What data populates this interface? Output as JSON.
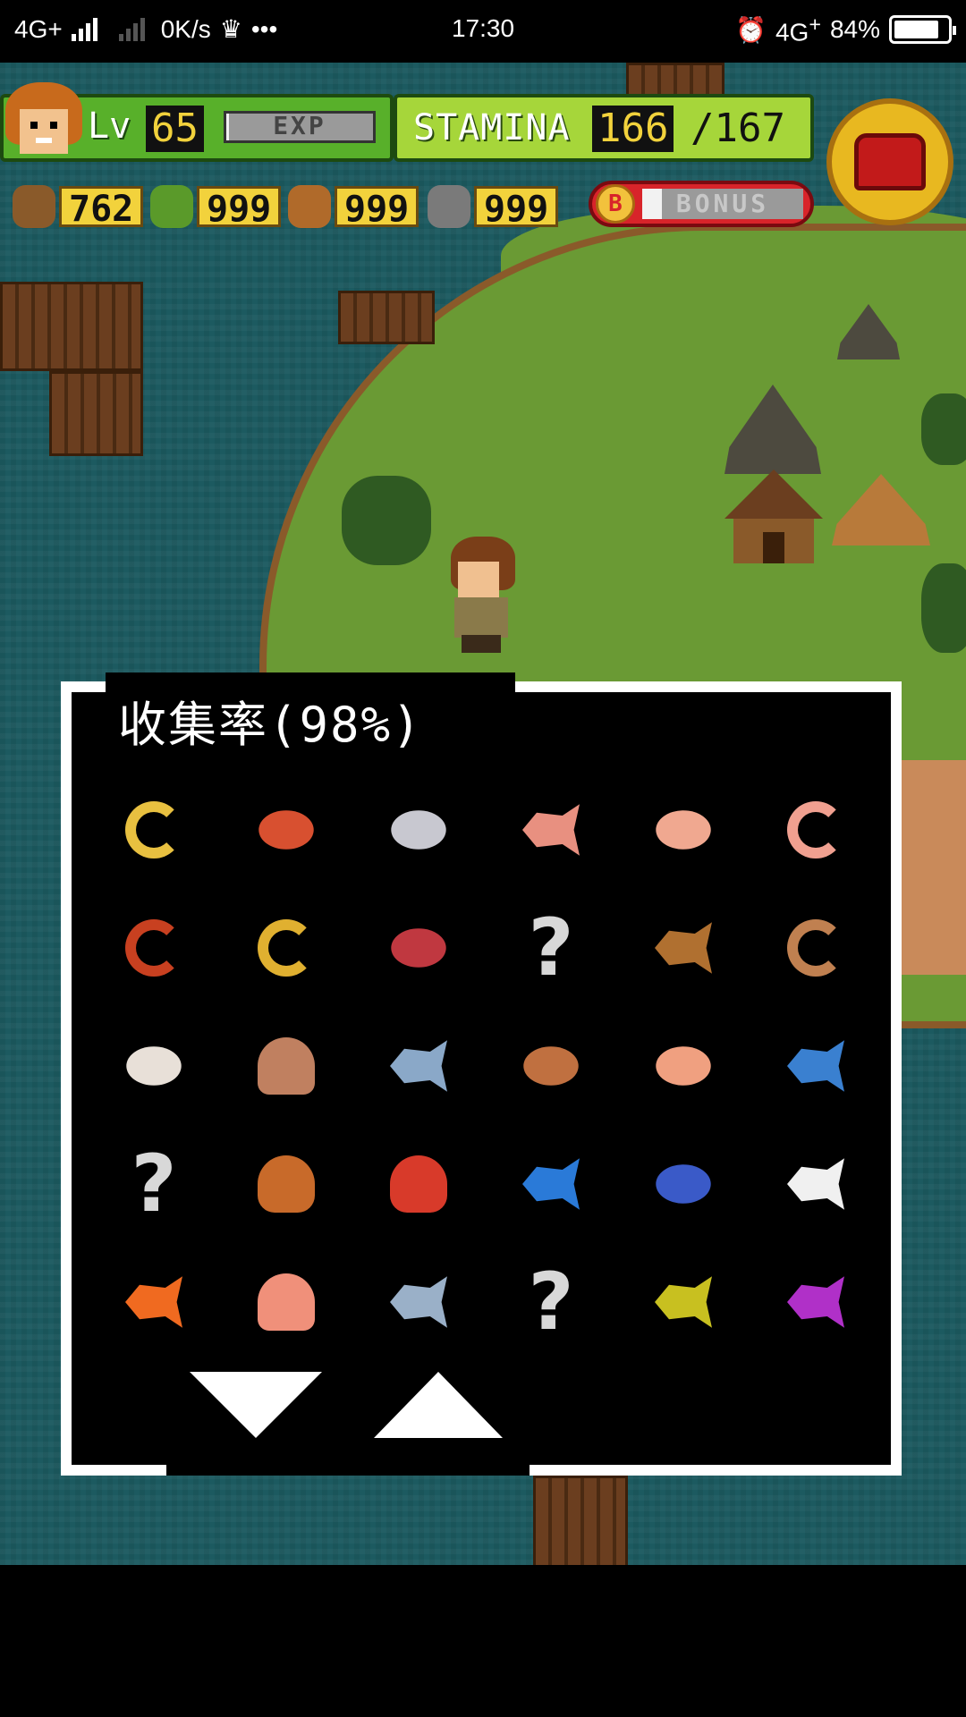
{
  "status_bar": {
    "network_left": "4G+",
    "speed": "0K/s",
    "dots": "•••",
    "time": "17:30",
    "network_right": "4G",
    "network_right_plus": "+",
    "battery": "84%",
    "battery_level": 0.84
  },
  "hud": {
    "lv_label": "Lv",
    "level": "65",
    "exp_label": "EXP",
    "exp_progress": 0.02,
    "stamina_label": "STAMINA",
    "stamina_current": "166",
    "stamina_max": "/167",
    "resources": [
      {
        "icon": "branch-icon",
        "value": "762",
        "color": "#8a5a2a"
      },
      {
        "icon": "leaf-icon",
        "value": "999",
        "color": "#5a9a2a"
      },
      {
        "icon": "nut-icon",
        "value": "999",
        "color": "#b06a2a"
      },
      {
        "icon": "stone-icon",
        "value": "999",
        "color": "#7a7a7a"
      }
    ],
    "bonus_coin": "B",
    "bonus_label": "BONUS",
    "bonus_progress": 0.12
  },
  "dialog": {
    "title": "收集率(98%)",
    "items": [
      {
        "name": "fried-shrimp-icon",
        "kind": "ring",
        "color": "#e8c040"
      },
      {
        "name": "raw-meat-icon",
        "kind": "meat",
        "color": "#d85030"
      },
      {
        "name": "silver-fish-ball-icon",
        "kind": "meat",
        "color": "#c8c8d0"
      },
      {
        "name": "salmon-fillet-icon",
        "kind": "fish",
        "color": "#e89080"
      },
      {
        "name": "pink-meat-icon",
        "kind": "meat",
        "color": "#f0a890"
      },
      {
        "name": "shrimp-icon",
        "kind": "ring",
        "color": "#f0a090"
      },
      {
        "name": "red-shrimp-icon",
        "kind": "ring",
        "color": "#c84020"
      },
      {
        "name": "yellow-shrimp-icon",
        "kind": "ring",
        "color": "#e0b030"
      },
      {
        "name": "red-meat-icon",
        "kind": "meat",
        "color": "#c03840"
      },
      {
        "name": "unknown-icon",
        "kind": "unknown",
        "color": "#d8d8d8"
      },
      {
        "name": "bread-icon",
        "kind": "fish",
        "color": "#b07030"
      },
      {
        "name": "brown-shrimp-icon",
        "kind": "ring",
        "color": "#c08050"
      },
      {
        "name": "salt-icon",
        "kind": "meat",
        "color": "#e8e0d8"
      },
      {
        "name": "clam-icon",
        "kind": "shell",
        "color": "#c08060"
      },
      {
        "name": "mackerel-icon",
        "kind": "fish",
        "color": "#8aa8c8"
      },
      {
        "name": "flatfish-icon",
        "kind": "meat",
        "color": "#c07040"
      },
      {
        "name": "pufferfish-icon",
        "kind": "meat",
        "color": "#f0a080"
      },
      {
        "name": "tuna-icon",
        "kind": "fish",
        "color": "#3a80d0"
      },
      {
        "name": "unknown-icon",
        "kind": "unknown",
        "color": "#d8d8d8"
      },
      {
        "name": "octopus-icon",
        "kind": "octo",
        "color": "#c86a2a"
      },
      {
        "name": "lobster-icon",
        "kind": "octo",
        "color": "#d83a2a"
      },
      {
        "name": "blue-fish-icon",
        "kind": "fish",
        "color": "#2a7ad8"
      },
      {
        "name": "tang-fish-icon",
        "kind": "meat",
        "color": "#3a5ac8"
      },
      {
        "name": "angelfish-icon",
        "kind": "fish",
        "color": "#f0f0f0"
      },
      {
        "name": "clownfish-icon",
        "kind": "fish",
        "color": "#f06a20"
      },
      {
        "name": "scallop-icon",
        "kind": "shell",
        "color": "#f0907a"
      },
      {
        "name": "sardine-icon",
        "kind": "fish",
        "color": "#9ab0c8"
      },
      {
        "name": "unknown-icon",
        "kind": "unknown",
        "color": "#d8d8d8"
      },
      {
        "name": "perch-icon",
        "kind": "fish",
        "color": "#c8c020"
      },
      {
        "name": "purple-fish-icon",
        "kind": "fish",
        "color": "#b030c8"
      }
    ],
    "page_down_icon": "triangle-down-icon",
    "page_up_icon": "triangle-up-icon"
  }
}
